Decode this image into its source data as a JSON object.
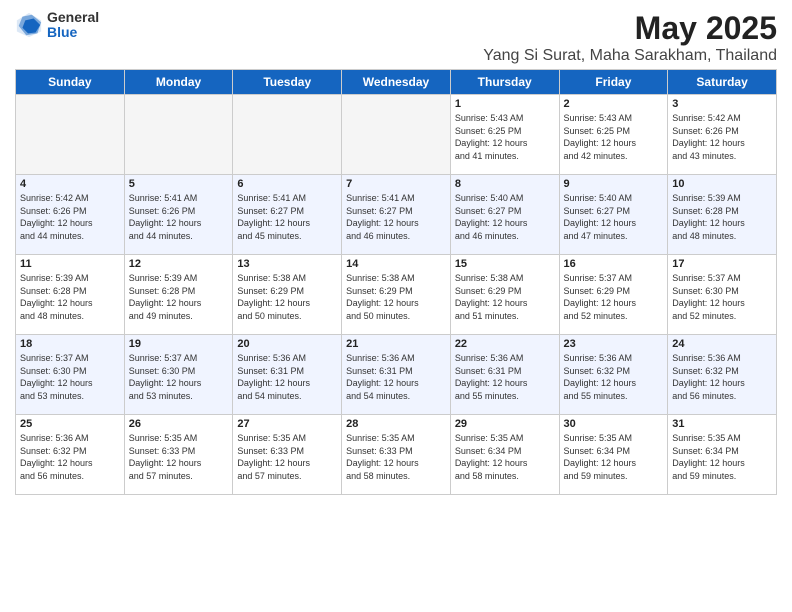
{
  "logo": {
    "general": "General",
    "blue": "Blue"
  },
  "title": "May 2025",
  "subtitle": "Yang Si Surat, Maha Sarakham, Thailand",
  "headers": [
    "Sunday",
    "Monday",
    "Tuesday",
    "Wednesday",
    "Thursday",
    "Friday",
    "Saturday"
  ],
  "weeks": [
    [
      {
        "day": "",
        "info": "",
        "empty": true
      },
      {
        "day": "",
        "info": "",
        "empty": true
      },
      {
        "day": "",
        "info": "",
        "empty": true
      },
      {
        "day": "",
        "info": "",
        "empty": true
      },
      {
        "day": "1",
        "info": "Sunrise: 5:43 AM\nSunset: 6:25 PM\nDaylight: 12 hours\nand 41 minutes.",
        "empty": false
      },
      {
        "day": "2",
        "info": "Sunrise: 5:43 AM\nSunset: 6:25 PM\nDaylight: 12 hours\nand 42 minutes.",
        "empty": false
      },
      {
        "day": "3",
        "info": "Sunrise: 5:42 AM\nSunset: 6:26 PM\nDaylight: 12 hours\nand 43 minutes.",
        "empty": false
      }
    ],
    [
      {
        "day": "4",
        "info": "Sunrise: 5:42 AM\nSunset: 6:26 PM\nDaylight: 12 hours\nand 44 minutes.",
        "empty": false
      },
      {
        "day": "5",
        "info": "Sunrise: 5:41 AM\nSunset: 6:26 PM\nDaylight: 12 hours\nand 44 minutes.",
        "empty": false
      },
      {
        "day": "6",
        "info": "Sunrise: 5:41 AM\nSunset: 6:27 PM\nDaylight: 12 hours\nand 45 minutes.",
        "empty": false
      },
      {
        "day": "7",
        "info": "Sunrise: 5:41 AM\nSunset: 6:27 PM\nDaylight: 12 hours\nand 46 minutes.",
        "empty": false
      },
      {
        "day": "8",
        "info": "Sunrise: 5:40 AM\nSunset: 6:27 PM\nDaylight: 12 hours\nand 46 minutes.",
        "empty": false
      },
      {
        "day": "9",
        "info": "Sunrise: 5:40 AM\nSunset: 6:27 PM\nDaylight: 12 hours\nand 47 minutes.",
        "empty": false
      },
      {
        "day": "10",
        "info": "Sunrise: 5:39 AM\nSunset: 6:28 PM\nDaylight: 12 hours\nand 48 minutes.",
        "empty": false
      }
    ],
    [
      {
        "day": "11",
        "info": "Sunrise: 5:39 AM\nSunset: 6:28 PM\nDaylight: 12 hours\nand 48 minutes.",
        "empty": false
      },
      {
        "day": "12",
        "info": "Sunrise: 5:39 AM\nSunset: 6:28 PM\nDaylight: 12 hours\nand 49 minutes.",
        "empty": false
      },
      {
        "day": "13",
        "info": "Sunrise: 5:38 AM\nSunset: 6:29 PM\nDaylight: 12 hours\nand 50 minutes.",
        "empty": false
      },
      {
        "day": "14",
        "info": "Sunrise: 5:38 AM\nSunset: 6:29 PM\nDaylight: 12 hours\nand 50 minutes.",
        "empty": false
      },
      {
        "day": "15",
        "info": "Sunrise: 5:38 AM\nSunset: 6:29 PM\nDaylight: 12 hours\nand 51 minutes.",
        "empty": false
      },
      {
        "day": "16",
        "info": "Sunrise: 5:37 AM\nSunset: 6:29 PM\nDaylight: 12 hours\nand 52 minutes.",
        "empty": false
      },
      {
        "day": "17",
        "info": "Sunrise: 5:37 AM\nSunset: 6:30 PM\nDaylight: 12 hours\nand 52 minutes.",
        "empty": false
      }
    ],
    [
      {
        "day": "18",
        "info": "Sunrise: 5:37 AM\nSunset: 6:30 PM\nDaylight: 12 hours\nand 53 minutes.",
        "empty": false
      },
      {
        "day": "19",
        "info": "Sunrise: 5:37 AM\nSunset: 6:30 PM\nDaylight: 12 hours\nand 53 minutes.",
        "empty": false
      },
      {
        "day": "20",
        "info": "Sunrise: 5:36 AM\nSunset: 6:31 PM\nDaylight: 12 hours\nand 54 minutes.",
        "empty": false
      },
      {
        "day": "21",
        "info": "Sunrise: 5:36 AM\nSunset: 6:31 PM\nDaylight: 12 hours\nand 54 minutes.",
        "empty": false
      },
      {
        "day": "22",
        "info": "Sunrise: 5:36 AM\nSunset: 6:31 PM\nDaylight: 12 hours\nand 55 minutes.",
        "empty": false
      },
      {
        "day": "23",
        "info": "Sunrise: 5:36 AM\nSunset: 6:32 PM\nDaylight: 12 hours\nand 55 minutes.",
        "empty": false
      },
      {
        "day": "24",
        "info": "Sunrise: 5:36 AM\nSunset: 6:32 PM\nDaylight: 12 hours\nand 56 minutes.",
        "empty": false
      }
    ],
    [
      {
        "day": "25",
        "info": "Sunrise: 5:36 AM\nSunset: 6:32 PM\nDaylight: 12 hours\nand 56 minutes.",
        "empty": false
      },
      {
        "day": "26",
        "info": "Sunrise: 5:35 AM\nSunset: 6:33 PM\nDaylight: 12 hours\nand 57 minutes.",
        "empty": false
      },
      {
        "day": "27",
        "info": "Sunrise: 5:35 AM\nSunset: 6:33 PM\nDaylight: 12 hours\nand 57 minutes.",
        "empty": false
      },
      {
        "day": "28",
        "info": "Sunrise: 5:35 AM\nSunset: 6:33 PM\nDaylight: 12 hours\nand 58 minutes.",
        "empty": false
      },
      {
        "day": "29",
        "info": "Sunrise: 5:35 AM\nSunset: 6:34 PM\nDaylight: 12 hours\nand 58 minutes.",
        "empty": false
      },
      {
        "day": "30",
        "info": "Sunrise: 5:35 AM\nSunset: 6:34 PM\nDaylight: 12 hours\nand 59 minutes.",
        "empty": false
      },
      {
        "day": "31",
        "info": "Sunrise: 5:35 AM\nSunset: 6:34 PM\nDaylight: 12 hours\nand 59 minutes.",
        "empty": false
      }
    ]
  ]
}
